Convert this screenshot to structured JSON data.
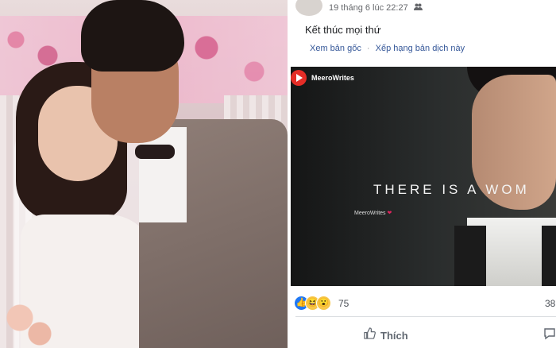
{
  "post": {
    "timestamp": "19 tháng 6 lúc 22:27",
    "audience_icon": "friends-icon",
    "caption": "Kết thúc mọi thứ",
    "see_original": "Xem bản gốc",
    "rate_translation": "Xếp hạng bản dịch này",
    "video": {
      "channel": "MeeroWrites",
      "overlay_text": "THERE IS A WOM",
      "watermark": "MeeroWrites"
    },
    "reaction_count": "75",
    "comment_count": "38",
    "like_label": "Thích"
  }
}
